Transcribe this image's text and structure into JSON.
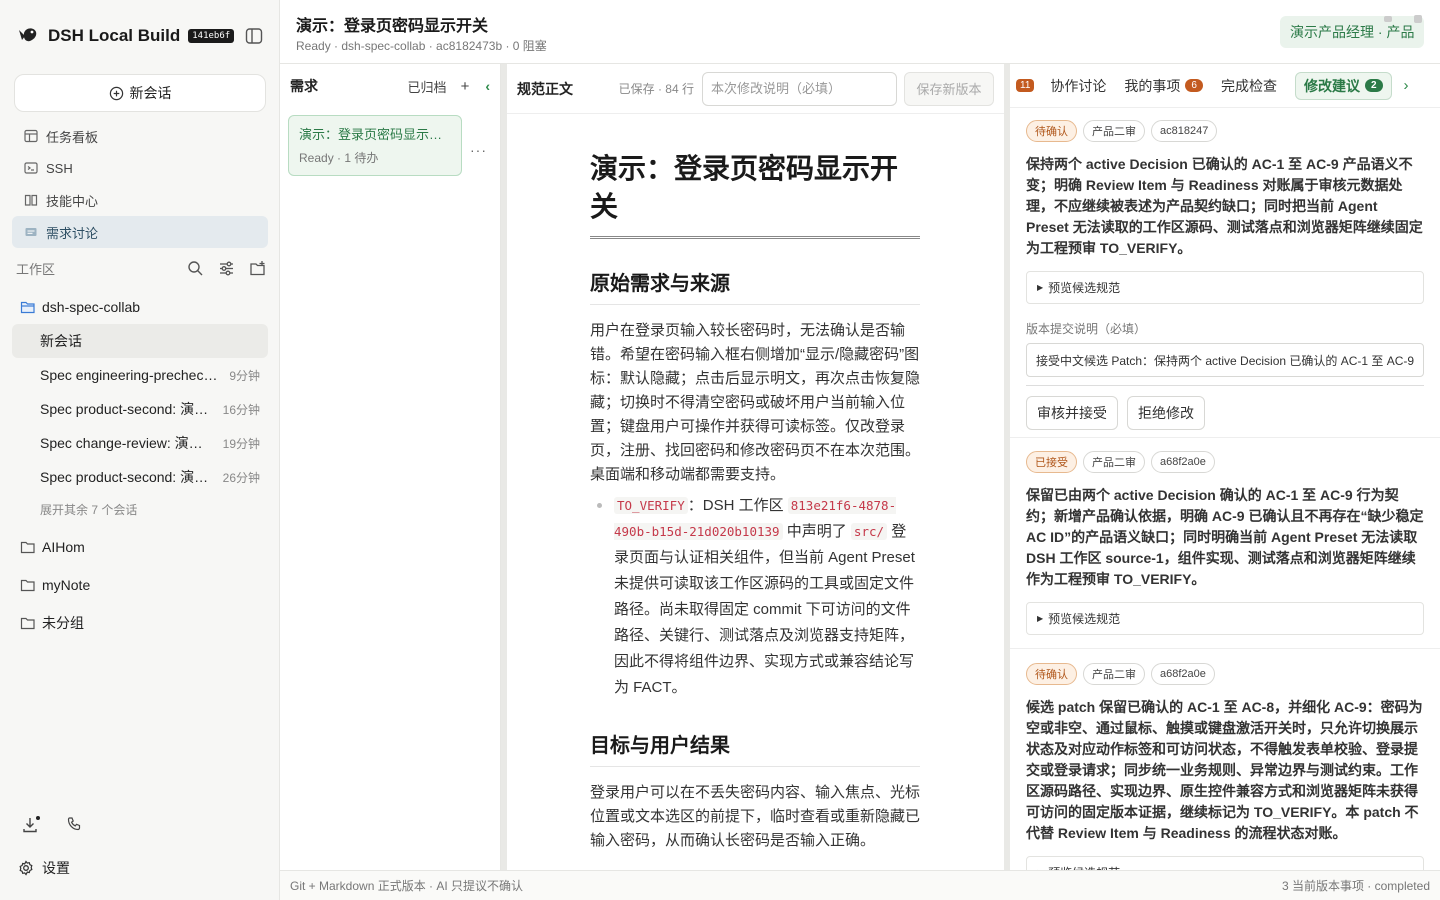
{
  "app": {
    "name": "DSH Local Build",
    "build": "141eb6f"
  },
  "sidebar": {
    "new_chat": "新会话",
    "nav": [
      {
        "label": "任务看板",
        "icon": "board-icon"
      },
      {
        "label": "SSH",
        "icon": "terminal-icon"
      },
      {
        "label": "技能中心",
        "icon": "book-icon"
      },
      {
        "label": "需求讨论",
        "icon": "discussion-icon",
        "active": true
      }
    ],
    "workspace_label": "工作区",
    "project": "dsh-spec-collab",
    "sessions": [
      {
        "title": "新会话",
        "time": ""
      },
      {
        "title": "Spec engineering-precheck…",
        "time": "9分钟"
      },
      {
        "title": "Spec product-second: 演示…",
        "time": "16分钟"
      },
      {
        "title": "Spec change-review: 演示…",
        "time": "19分钟"
      },
      {
        "title": "Spec product-second: 演示…",
        "time": "26分钟"
      }
    ],
    "expand_more": "展开其余 7 个会话",
    "other_projects": [
      "AIHom",
      "myNote",
      "未分组"
    ],
    "settings": "设置"
  },
  "topbar": {
    "title": "演示：登录页密码显示开关",
    "subtitle": "Ready · dsh-spec-collab · ac8182473b · 0 阻塞",
    "role": "演示产品经理 · 产品"
  },
  "requirements": {
    "header": "需求",
    "archived": "已归档",
    "add": "+",
    "collapse": "‹",
    "card_title": "演示：登录页密码显示开关",
    "card_status": "Ready · 1 待办",
    "card_menu": "···"
  },
  "spec": {
    "label": "规范正文",
    "saved": "已保存 · 84 行",
    "note_placeholder": "本次修改说明（必填）",
    "save_button": "保存新版本",
    "doc_title": "演示：登录页密码显示开关",
    "h2_source": "原始需求与来源",
    "p_source": "用户在登录页输入较长密码时，无法确认是否输错。希望在密码输入框右侧增加“显示/隐藏密码”图标：默认隐藏；点击后显示明文，再次点击恢复隐藏；切换时不得清空密码或破坏用户当前输入位置；键盘用户可操作并获得可读标签。仅改登录页，注册、找回密码和修改密码页不在本次范围。桌面端和移动端都需要支持。",
    "bullet_code1": "TO_VERIFY",
    "bullet_t1": "：DSH 工作区 ",
    "bullet_code2": "813e21f6-4878-490b-b15d-21d020b10139",
    "bullet_t2": " 中声明了 ",
    "bullet_code3": "src/",
    "bullet_t3": " 登录页面与认证相关组件，但当前 Agent Preset 未提供可读取该工作区源码的工具或固定文件路径。尚未取得固定 commit 下可访问的文件路径、关键行、测试落点及浏览器支持矩阵，因此不得将组件边界、实现方式或兼容结论写为 FACT。",
    "h2_goal": "目标与用户结果",
    "p_goal": "登录用户可以在不丢失密码内容、输入焦点、光标位置或文本选区的前提下，临时查看或重新隐藏已输入密码，从而确认长密码是否输入正确。"
  },
  "review": {
    "count": "11",
    "tabs": [
      {
        "label": "协作讨论",
        "badge": ""
      },
      {
        "label": "我的事项",
        "badge": "6"
      },
      {
        "label": "完成检查",
        "badge": ""
      },
      {
        "label": "修改建议",
        "badge": "2",
        "active": true
      }
    ],
    "next": "›",
    "cards": [
      {
        "status": "待确认",
        "stage": "产品二审",
        "commit": "ac818247",
        "desc": "保持两个 active Decision 已确认的 AC-1 至 AC-9 产品语义不变；明确 Review Item 与 Readiness 对账属于审核元数据处理，不应继续被表述为产品契约缺口；同时把当前 Agent Preset 无法读取的工作区源码、测试落点和浏览器矩阵继续固定为工程预审 TO_VERIFY。",
        "preview": "预览候选规范",
        "commit_label": "版本提交说明（必填）",
        "commit_value": "接受中文候选 Patch：保持两个 active Decision 已确认的 AC-1 至 AC-9",
        "accept": "审核并接受",
        "reject": "拒绝修改"
      },
      {
        "status": "已接受",
        "stage": "产品二审",
        "commit": "a68f2a0e",
        "desc": "保留已由两个 active Decision 确认的 AC-1 至 AC-9 行为契约；新增产品确认依据，明确 AC-9 已确认且不再存在“缺少稳定 AC ID”的产品语义缺口；同时明确当前 Agent Preset 无法读取 DSH 工作区 source-1，组件实现、测试落点和浏览器矩阵继续作为工程预审 TO_VERIFY。",
        "preview": "预览候选规范"
      },
      {
        "status": "待确认",
        "stage": "产品二审",
        "commit": "a68f2a0e",
        "desc": "候选 patch 保留已确认的 AC-1 至 AC-8，并细化 AC-9：密码为空或非空、通过鼠标、触摸或键盘激活开关时，只允许切换展示状态及对应动作标签和可访问状态，不得触发表单校验、登录提交或登录请求；同步统一业务规则、异常边界与测试约束。工作区源码路径、实现边界、原生控件兼容方式和浏览器矩阵未获得可访问的固定版本证据，继续标记为 TO_VERIFY。本 patch 不代替 Review Item 与 Readiness 的流程状态对账。",
        "preview": "预览候选规范"
      }
    ]
  },
  "statusbar": {
    "left": "Git + Markdown 正式版本 · AI 只提议不确认",
    "right": "3 当前版本事项 · completed"
  }
}
